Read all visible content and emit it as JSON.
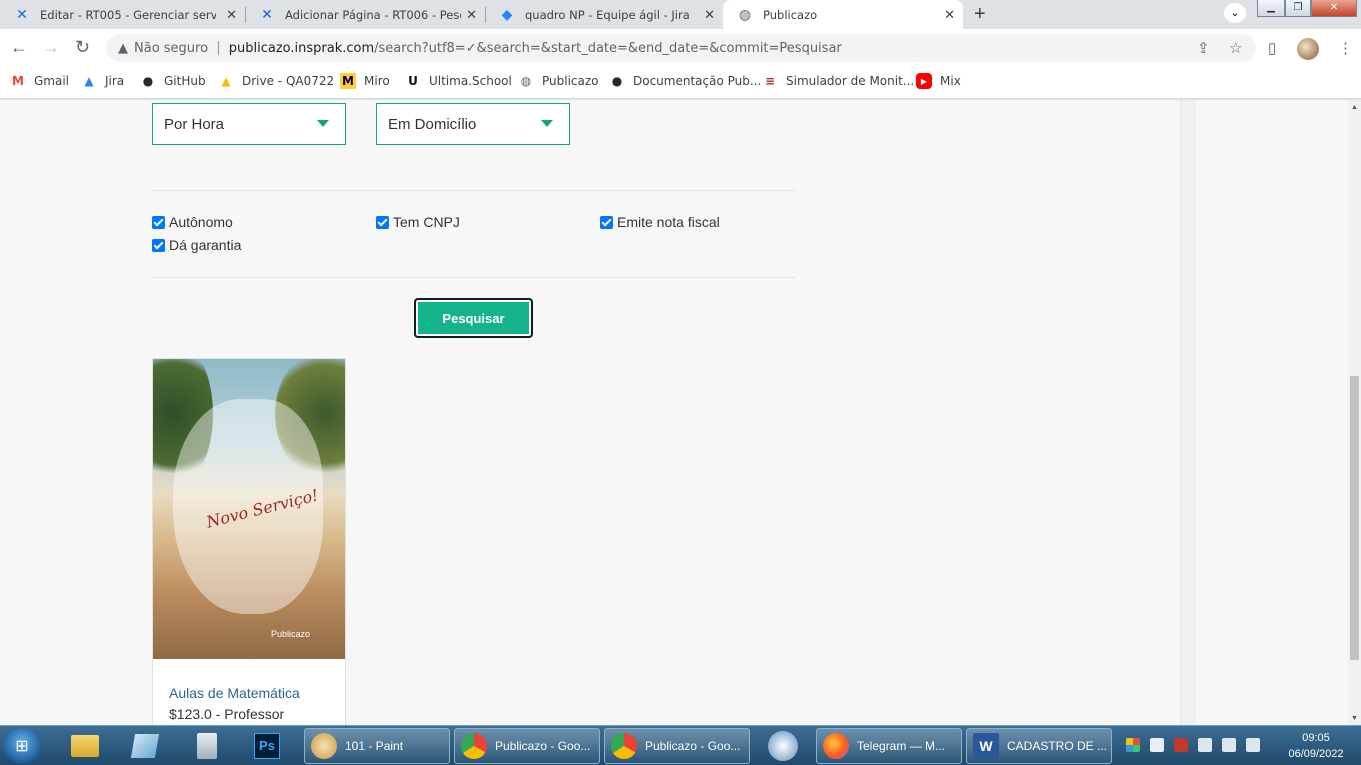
{
  "browser": {
    "tabs": [
      {
        "title": "Editar - RT005 - Gerenciar serviço",
        "icon": "confluence-icon"
      },
      {
        "title": "Adicionar Página - RT006 - Pesqu",
        "icon": "confluence-icon"
      },
      {
        "title": "quadro NP - Equipe ágil - Jira",
        "icon": "jira-icon"
      },
      {
        "title": "Publicazo",
        "icon": "globe-icon"
      }
    ],
    "security_label": "Não seguro",
    "url_host": "publicazo.insprak.com",
    "url_path": "/search?utf8=✓&search=&start_date=&end_date=&commit=Pesquisar",
    "bookmarks": [
      {
        "label": "Gmail",
        "icon": "gmail-icon"
      },
      {
        "label": "Jira",
        "icon": "jira-icon"
      },
      {
        "label": "GitHub",
        "icon": "github-icon"
      },
      {
        "label": "Drive - QA0722",
        "icon": "drive-icon"
      },
      {
        "label": "Miro",
        "icon": "miro-icon"
      },
      {
        "label": "Ultima.School",
        "icon": "ultima-icon"
      },
      {
        "label": "Publicazo",
        "icon": "globe-icon"
      },
      {
        "label": "Documentação Pub...",
        "icon": "github-icon"
      },
      {
        "label": "Simulador de Monit...",
        "icon": "simulator-icon"
      },
      {
        "label": "Mix",
        "icon": "youtube-icon"
      }
    ]
  },
  "filters": {
    "period_select": "Por Hora",
    "location_select": "Em Domicílio",
    "checkboxes": [
      {
        "label": "Autônomo",
        "checked": true
      },
      {
        "label": "Tem CNPJ",
        "checked": true
      },
      {
        "label": "Emite nota fiscal",
        "checked": true
      },
      {
        "label": "Dá garantia",
        "checked": true
      }
    ],
    "search_button": "Pesquisar"
  },
  "results": [
    {
      "image_script_text": "Novo Serviço!",
      "image_brand_text": "Publicazo",
      "title": "Aulas de Matemática",
      "price_line": "$123.0 - Professor"
    }
  ],
  "taskbar": {
    "windows": [
      {
        "label": "101 - Paint",
        "icon": "paint-icon"
      },
      {
        "label": "Publicazo - Goo...",
        "icon": "chrome-icon"
      },
      {
        "label": "Publicazo - Goo...",
        "icon": "chrome-icon"
      },
      {
        "label": "",
        "icon": "outlook-icon"
      },
      {
        "label": "Telegram — M...",
        "icon": "firefox-icon"
      },
      {
        "label": "CADASTRO DE ...",
        "icon": "word-icon"
      }
    ],
    "time": "09:05",
    "date": "06/09/2022"
  }
}
